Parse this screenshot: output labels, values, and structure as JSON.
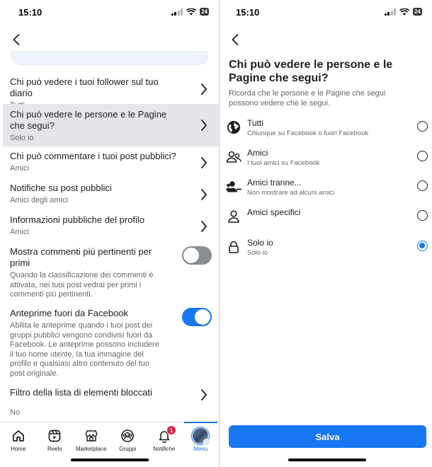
{
  "status_left": {
    "time": "15:10",
    "battery": "24"
  },
  "status_right": {
    "time": "15:10",
    "battery": "24"
  },
  "left": {
    "rows": [
      {
        "title": "Chi può vedere i tuoi follower sul tuo diario",
        "sub": "Tutti"
      },
      {
        "title": "Chi può vedere le persone e le Pagine che segui?",
        "sub": "Solo io"
      },
      {
        "title": "Chi può commentare i tuoi post pubblici?",
        "sub": "Amici"
      },
      {
        "title": "Notifiche su post pubblici",
        "sub": "Amici degli amici"
      },
      {
        "title": "Informazioni pubbliche del profilo",
        "sub": "Amici"
      }
    ],
    "toggles": [
      {
        "title": "Mostra commenti più pertinenti per primi",
        "desc": "Quando la classificazione dei commenti è attivata, nei tuoi post vedrai per primi i commenti più pertinenti.",
        "on": false
      },
      {
        "title": "Anteprime fuori da Facebook",
        "desc": "Abilita le anteprime quando i tuoi post dei gruppi pubblici vengono condivisi fuori da Facebook. Le anteprime possono includere il tuo nome utente, la tua immagine del profilo e qualsiasi altro contenuto del tuo post originale.",
        "on": true
      }
    ],
    "blocked": {
      "title": "Filtro della lista di elementi bloccati",
      "sub": "No"
    }
  },
  "tabbar": {
    "items": [
      {
        "label": "Home",
        "icon": "home-icon"
      },
      {
        "label": "Reels",
        "icon": "reels-icon"
      },
      {
        "label": "Marketplace",
        "icon": "marketplace-icon"
      },
      {
        "label": "Gruppi",
        "icon": "groups-icon"
      },
      {
        "label": "Notifiche",
        "icon": "bell-icon",
        "badge": "1"
      },
      {
        "label": "Menu",
        "icon": "avatar",
        "active": true
      }
    ]
  },
  "right": {
    "title": "Chi può vedere le persone e le Pagine che segui?",
    "description": "Ricorda che le persone e le Pagine che segui possono vedere che le segui.",
    "options": [
      {
        "label": "Tutti",
        "sub": "Chiunque su Facebook o fuori Facebook",
        "icon": "globe-icon",
        "selected": false
      },
      {
        "label": "Amici",
        "sub": "I tuoi amici su Facebook",
        "icon": "friends-icon",
        "selected": false
      },
      {
        "label": "Amici tranne...",
        "sub": "Non mostrare ad alcuni amici",
        "icon": "friends-except-icon",
        "selected": false
      },
      {
        "label": "Amici specifici",
        "sub": "",
        "icon": "person-icon",
        "selected": false
      },
      {
        "label": "Solo io",
        "sub": "Solo io",
        "icon": "lock-icon",
        "selected": true
      }
    ],
    "save_label": "Salva"
  },
  "colors": {
    "accent": "#1877f2",
    "badge": "#e41e3f",
    "selected_row": "#e4e6eb"
  }
}
